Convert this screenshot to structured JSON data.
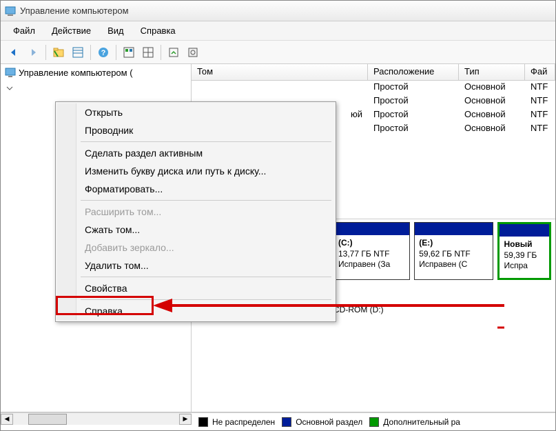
{
  "window": {
    "title": "Управление компьютером"
  },
  "menu": {
    "file": "Файл",
    "action": "Действие",
    "view": "Вид",
    "help": "Справка"
  },
  "tree": {
    "root": "Управление компьютером ("
  },
  "columns": {
    "volume": "Том",
    "layout": "Расположение",
    "type": "Тип",
    "fs": "Фай"
  },
  "rows": [
    {
      "vol": "",
      "layout": "Простой",
      "type": "Основной",
      "fs": "NTF"
    },
    {
      "vol": "",
      "layout": "Простой",
      "type": "Основной",
      "fs": "NTF"
    },
    {
      "vol": "юй",
      "layout": "Простой",
      "type": "Основной",
      "fs": "NTF"
    },
    {
      "vol": "",
      "layout": "Простой",
      "type": "Основной",
      "fs": "NTF"
    }
  ],
  "partitions": [
    {
      "name": "(C:)",
      "size": "13,77 ГБ NTF",
      "status": "Исправен (За"
    },
    {
      "name": "(E:)",
      "size": "59,62 ГБ NTF",
      "status": "Исправен (С"
    },
    {
      "name": "Новый",
      "size": "59,39 ГБ",
      "status": "Испра"
    }
  ],
  "cdrom": "CD-ROM (D:)",
  "legend": {
    "unalloc": "Не распределен",
    "primary": "Основной раздел",
    "extended": "Дополнительный ра"
  },
  "context": {
    "open": "Открыть",
    "explorer": "Проводник",
    "make_active": "Сделать раздел активным",
    "change_letter": "Изменить букву диска или путь к диску...",
    "format": "Форматировать...",
    "extend": "Расширить том...",
    "shrink": "Сжать том...",
    "mirror": "Добавить зеркало...",
    "delete": "Удалить том...",
    "properties": "Свойства",
    "help": "Справка"
  }
}
